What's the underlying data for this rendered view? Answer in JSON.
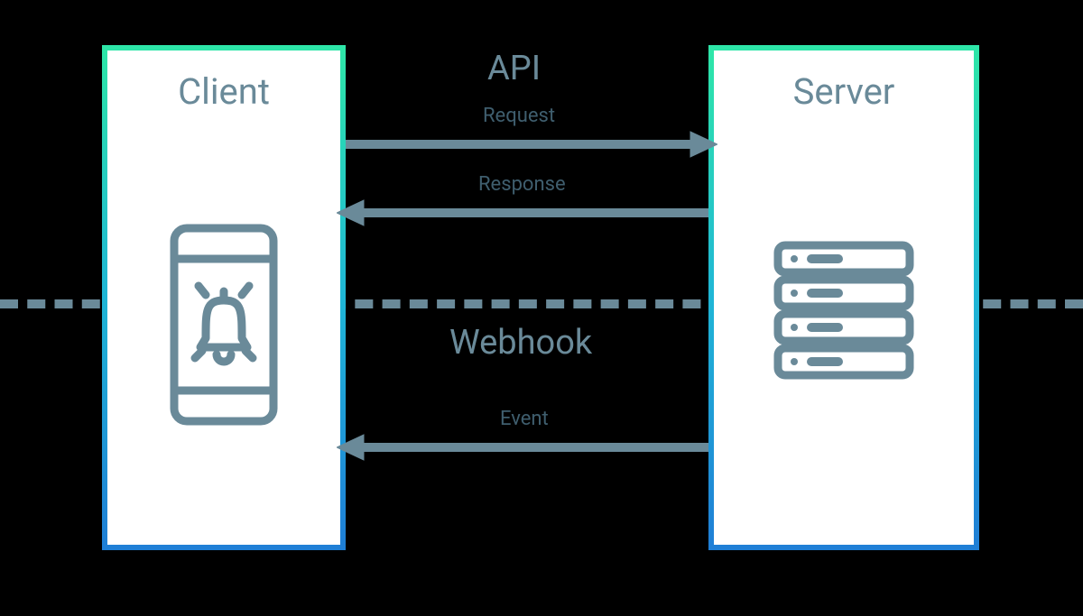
{
  "diagram": {
    "client": {
      "title": "Client"
    },
    "server": {
      "title": "Server"
    },
    "sections": {
      "api": "API",
      "webhook": "Webhook"
    },
    "arrows": {
      "request": "Request",
      "response": "Response",
      "event": "Event"
    }
  }
}
